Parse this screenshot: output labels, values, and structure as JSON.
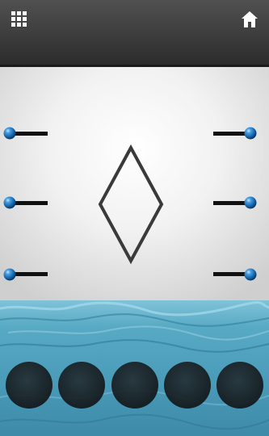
{
  "header": {
    "menu_icon": "grid-menu-icon",
    "home_icon": "home-icon"
  },
  "puzzle": {
    "shape": "diamond",
    "lever_count_per_side": 3,
    "inventory_slot_count": 5
  },
  "colors": {
    "header_bg": "#3b3b3b",
    "wall": "#f2f2f2",
    "diamond_stroke": "#3a3a3a",
    "knob": "#1b73b8",
    "water": "#4d9fbc",
    "slot": "#14191c"
  }
}
